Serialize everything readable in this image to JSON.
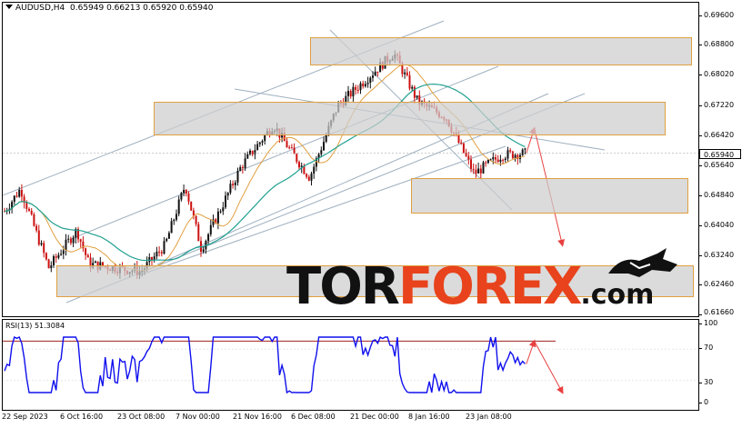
{
  "header": {
    "symbol": "AUDUSD,H4",
    "ohlc": "0.65949 0.66213 0.65920 0.65940"
  },
  "price_axis": {
    "ticks": [
      "0.69600",
      "0.68800",
      "0.68020",
      "0.67220",
      "0.66420",
      "0.65640",
      "0.64840",
      "0.64040",
      "0.63240",
      "0.62460",
      "0.61660"
    ],
    "current_price": "0.65940"
  },
  "rsi": {
    "title": "RSI(13) 51.3084",
    "ticks": [
      "100",
      "70",
      "30",
      "0"
    ]
  },
  "time_axis": {
    "ticks": [
      "22 Sep 2023",
      "6 Oct 16:00",
      "23 Oct 08:00",
      "7 Nov 00:00",
      "21 Nov 16:00",
      "6 Dec 08:00",
      "21 Dec 00:00",
      "8 Jan 16:00",
      "23 Jan 08:00"
    ]
  },
  "watermark": {
    "part1": "TOR",
    "part2": "FOREX",
    "part3": ".com"
  },
  "colors": {
    "bull_candle": "#111111",
    "bear_candle": "#cc1111",
    "ma_fast": "#e0a040",
    "ma_slow": "#20a090",
    "trend_lines": "#9fb0c0",
    "forecast": "#e84040",
    "rsi_line": "#1010ee",
    "rsi_level": "#a02020",
    "zone_fill": "#cdcdcd",
    "zone_border": "#e0a040",
    "brand_orange": "#e8431c"
  },
  "chart_data": [
    {
      "type": "candlestick",
      "title": "AUDUSD,H4",
      "ylim": [
        0.6166,
        0.696
      ],
      "x_range": [
        "22 Sep 2023",
        "30 Jan 2024"
      ],
      "key_points": [
        {
          "x": "22 Sep 2023",
          "y": 0.644
        },
        {
          "x": "26 Sep 2023",
          "y": 0.65
        },
        {
          "x": "3 Oct 2023",
          "y": 0.629
        },
        {
          "x": "10 Oct 2023",
          "y": 0.639
        },
        {
          "x": "13 Oct 2023",
          "y": 0.63
        },
        {
          "x": "26 Oct 2023",
          "y": 0.628
        },
        {
          "x": "1 Nov 2023",
          "y": 0.635
        },
        {
          "x": "6 Nov 2023",
          "y": 0.651
        },
        {
          "x": "10 Nov 2023",
          "y": 0.634
        },
        {
          "x": "20 Nov 2023",
          "y": 0.656
        },
        {
          "x": "28 Nov 2023",
          "y": 0.667
        },
        {
          "x": "1 Dec 2023",
          "y": 0.662
        },
        {
          "x": "7 Dec 2023",
          "y": 0.653
        },
        {
          "x": "14 Dec 2023",
          "y": 0.672
        },
        {
          "x": "22 Dec 2023",
          "y": 0.68
        },
        {
          "x": "28 Dec 2023",
          "y": 0.686
        },
        {
          "x": "3 Jan 2024",
          "y": 0.673
        },
        {
          "x": "10 Jan 2024",
          "y": 0.669
        },
        {
          "x": "17 Jan 2024",
          "y": 0.654
        },
        {
          "x": "24 Jan 2024",
          "y": 0.659
        },
        {
          "x": "30 Jan 2024",
          "y": 0.6594
        }
      ],
      "forecast": [
        {
          "x": "30 Jan 2024",
          "y": 0.6594
        },
        {
          "x": "1 Feb 2024",
          "y": 0.666
        },
        {
          "x": "8 Feb 2024",
          "y": 0.635
        }
      ],
      "zones": [
        {
          "from": 0.6825,
          "to": 0.6895
        },
        {
          "from": 0.665,
          "to": 0.674
        },
        {
          "from": 0.6445,
          "to": 0.654
        },
        {
          "from": 0.622,
          "to": 0.6295
        }
      ]
    },
    {
      "type": "line",
      "title": "RSI(13) 51.3084",
      "ylim": [
        0,
        100
      ],
      "levels": [
        30,
        70
      ],
      "last_value": 51.3084,
      "forecast": [
        {
          "x": "30 Jan 2024",
          "y": 51
        },
        {
          "x": "1 Feb 2024",
          "y": 80
        },
        {
          "x": "8 Feb 2024",
          "y": 15
        }
      ]
    }
  ]
}
